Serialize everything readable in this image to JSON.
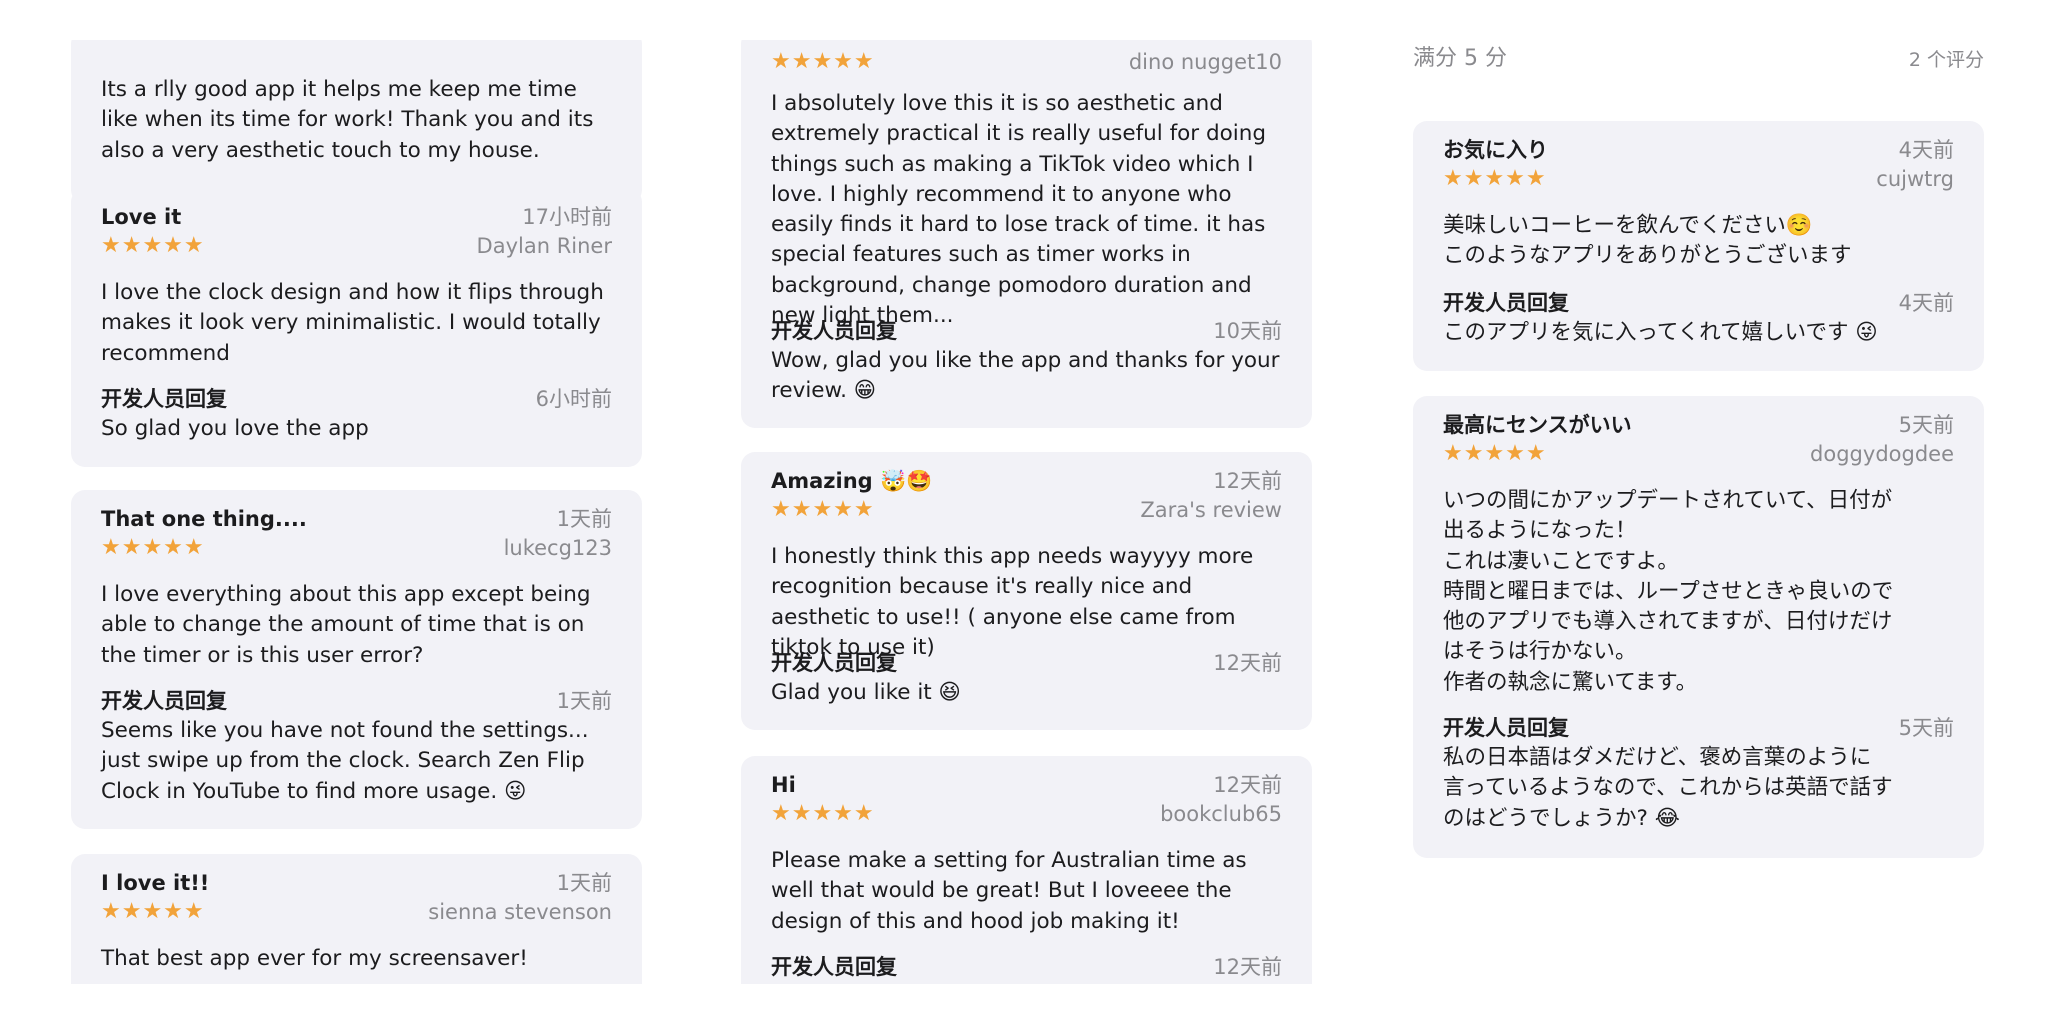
{
  "column1": {
    "cards": [
      {
        "body": "Its a rlly good app it helps me keep me time like when its time for work! Thank you and its also a very aesthetic touch to my house."
      },
      {
        "title": "Love it",
        "time": "17小时前",
        "stars": "★★★★★",
        "author": "Daylan Riner",
        "body": "I love the clock design and how it flips through makes it look very minimalistic. I would totally recommend",
        "dev_label": "开发人员回复",
        "dev_time": "6小时前",
        "dev_body": "So glad you love the app"
      },
      {
        "title": "That one thing....",
        "time": "1天前",
        "stars": "★★★★★",
        "author": "lukecg123",
        "body": "I love everything about this app except being able to change the amount of time that is on the timer or is this user error?",
        "dev_label": "开发人员回复",
        "dev_time": "1天前",
        "dev_body": "Seems like you have not found the settings... just swipe up from the clock. Search Zen Flip Clock in YouTube to find more usage. 😜"
      },
      {
        "title": "I love it!!",
        "time": "1天前",
        "stars": "★★★★★",
        "author": "sienna stevenson",
        "body": "That best app ever for my screensaver!"
      }
    ]
  },
  "column2": {
    "cards": [
      {
        "stars": "★★★★★",
        "author": "dino nugget10",
        "body": "I absolutely love this it is so aesthetic and extremely practical it is really useful for doing things such as making a TikTok video which I love. I highly recommend it to anyone who easily finds it hard to lose track of time.  it has special features such as timer works in background, change pomodoro duration and new light them...",
        "dev_label": "开发人员回复",
        "dev_time": "10天前",
        "dev_body": "Wow, glad you like the app and thanks for your review. 😁"
      },
      {
        "title": "Amazing 🤯🤩",
        "time": "12天前",
        "stars": "★★★★★",
        "author": "Zara's review",
        "body": "I honestly think this app needs wayyyy more recognition because it's really nice and aesthetic to use!! ( anyone else came from tiktok to use it)",
        "dev_label": "开发人员回复",
        "dev_time": "12天前",
        "dev_body": "Glad you like it 😆"
      },
      {
        "title": "Hi",
        "time": "12天前",
        "stars": "★★★★★",
        "author": "bookclub65",
        "body": "Please make a setting for Australian time as well that would be great! But I loveeee the design of this and hood job making it!",
        "dev_label": "开发人员回复",
        "dev_time": "12天前"
      }
    ]
  },
  "column3": {
    "summary_left": "满分 5 分",
    "summary_right": "2 个评分",
    "cards": [
      {
        "title": "お気に入り",
        "time": "4天前",
        "stars": "★★★★★",
        "author": "cujwtrg",
        "body": "美味しいコーヒーを飲んでください☺️\nこのようなアプリをありがとうございます",
        "dev_label": "开发人员回复",
        "dev_time": "4天前",
        "dev_body": "このアプリを気に入ってくれて嬉しいです 😜"
      },
      {
        "title": "最高にセンスがいい",
        "time": "5天前",
        "stars": "★★★★★",
        "author": "doggydogdee",
        "body": "いつの間にかアップデートされていて、日付が\n出るようになった！\nこれは凄いことですよ。\n時間と曜日までは、ループさせときゃ良いので\n他のアプリでも導入されてますが、日付けだけ\nはそうは行かない。\n作者の執念に驚いてます。",
        "dev_label": "开发人员回复",
        "dev_time": "5天前",
        "dev_body": "私の日本語はダメだけど、褒め言葉のように\n言っているようなので、これからは英語で話す\nのはどうでしょうか?  😂"
      }
    ]
  }
}
